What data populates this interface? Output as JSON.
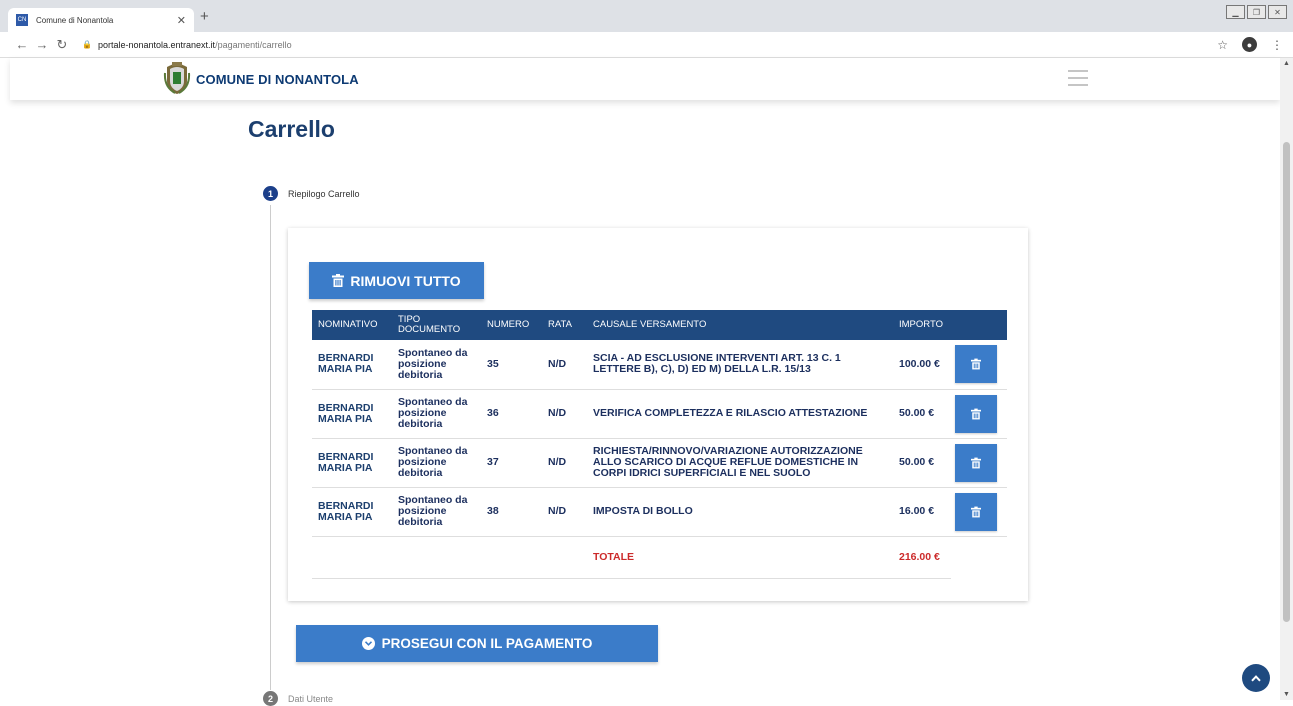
{
  "browser": {
    "tab_title": "Comune di Nonantola",
    "favicon_text": "CN",
    "url_host": "portale-nonantola.entranext.it",
    "url_path": "/pagamenti/carrello"
  },
  "header": {
    "site_name": "COMUNE DI NONANTOLA"
  },
  "page": {
    "title": "Carrello",
    "step1_number": "1",
    "step1_label": "Riepilogo Carrello",
    "step2_number": "2",
    "step2_label": "Dati Utente"
  },
  "cart": {
    "remove_all_label": "RIMUOVI TUTTO",
    "columns": {
      "nominativo": "NOMINATIVO",
      "tipo": "TIPO DOCUMENTO",
      "numero": "NUMERO",
      "rata": "RATA",
      "causale": "CAUSALE VERSAMENTO",
      "importo": "IMPORTO"
    },
    "rows": [
      {
        "nominativo": "BERNARDI MARIA PIA",
        "tipo": "Spontaneo da posizione debitoria",
        "numero": "35",
        "rata": "N/D",
        "causale": "SCIA - AD ESCLUSIONE INTERVENTI ART. 13 C. 1 LETTERE B), C), D) ED M) DELLA L.R. 15/13",
        "importo": "100.00 €"
      },
      {
        "nominativo": "BERNARDI MARIA PIA",
        "tipo": "Spontaneo da posizione debitoria",
        "numero": "36",
        "rata": "N/D",
        "causale": "VERIFICA COMPLETEZZA E RILASCIO ATTESTAZIONE",
        "importo": "50.00 €"
      },
      {
        "nominativo": "BERNARDI MARIA PIA",
        "tipo": "Spontaneo da posizione debitoria",
        "numero": "37",
        "rata": "N/D",
        "causale": "RICHIESTA/RINNOVO/VARIAZIONE AUTORIZZAZIONE ALLO SCARICO DI ACQUE REFLUE DOMESTICHE IN CORPI IDRICI SUPERFICIALI E NEL SUOLO",
        "importo": "50.00 €"
      },
      {
        "nominativo": "BERNARDI MARIA PIA",
        "tipo": "Spontaneo da posizione debitoria",
        "numero": "38",
        "rata": "N/D",
        "causale": "IMPOSTA DI BOLLO",
        "importo": "16.00 €"
      }
    ],
    "total_label": "TOTALE",
    "total_value": "216.00 €",
    "proceed_label": "PROSEGUI CON IL PAGAMENTO"
  },
  "colors": {
    "primary_button": "#3b7cc9",
    "table_header": "#1f4a80",
    "total_red": "#cc2a2a",
    "title_blue": "#1c3f6e"
  }
}
